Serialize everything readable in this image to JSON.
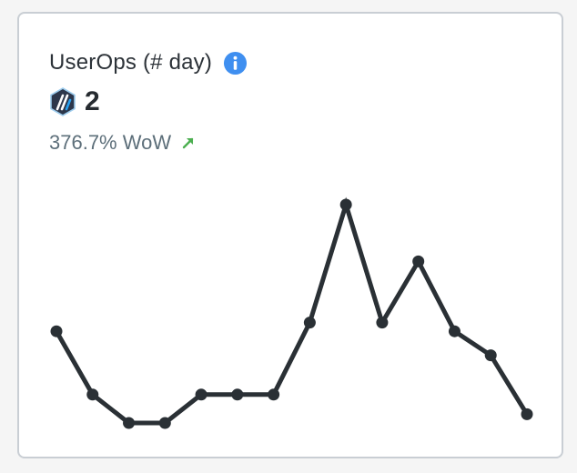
{
  "card": {
    "title": "UserOps (# day)",
    "value": "2",
    "wow": "376.7% WoW"
  },
  "icons": {
    "info": "info-icon",
    "network_logo": "arbitrum-logo",
    "trend": "arrow-up-right-icon"
  },
  "colors": {
    "line": "#2a3035",
    "info": "#3f8ff0",
    "trend_up": "#4caf50",
    "border": "#c9ced4"
  },
  "chart_data": {
    "type": "line",
    "x": [
      1,
      2,
      3,
      4,
      5,
      6,
      7,
      8,
      9,
      10,
      11,
      12,
      13,
      14
    ],
    "values": [
      0.42,
      0.13,
      0.0,
      0.0,
      0.13,
      0.13,
      0.13,
      0.46,
      1.0,
      0.46,
      0.74,
      0.42,
      0.31,
      0.04
    ],
    "title": "",
    "xlabel": "",
    "ylabel": "",
    "grid": false,
    "axes_visible": false
  }
}
